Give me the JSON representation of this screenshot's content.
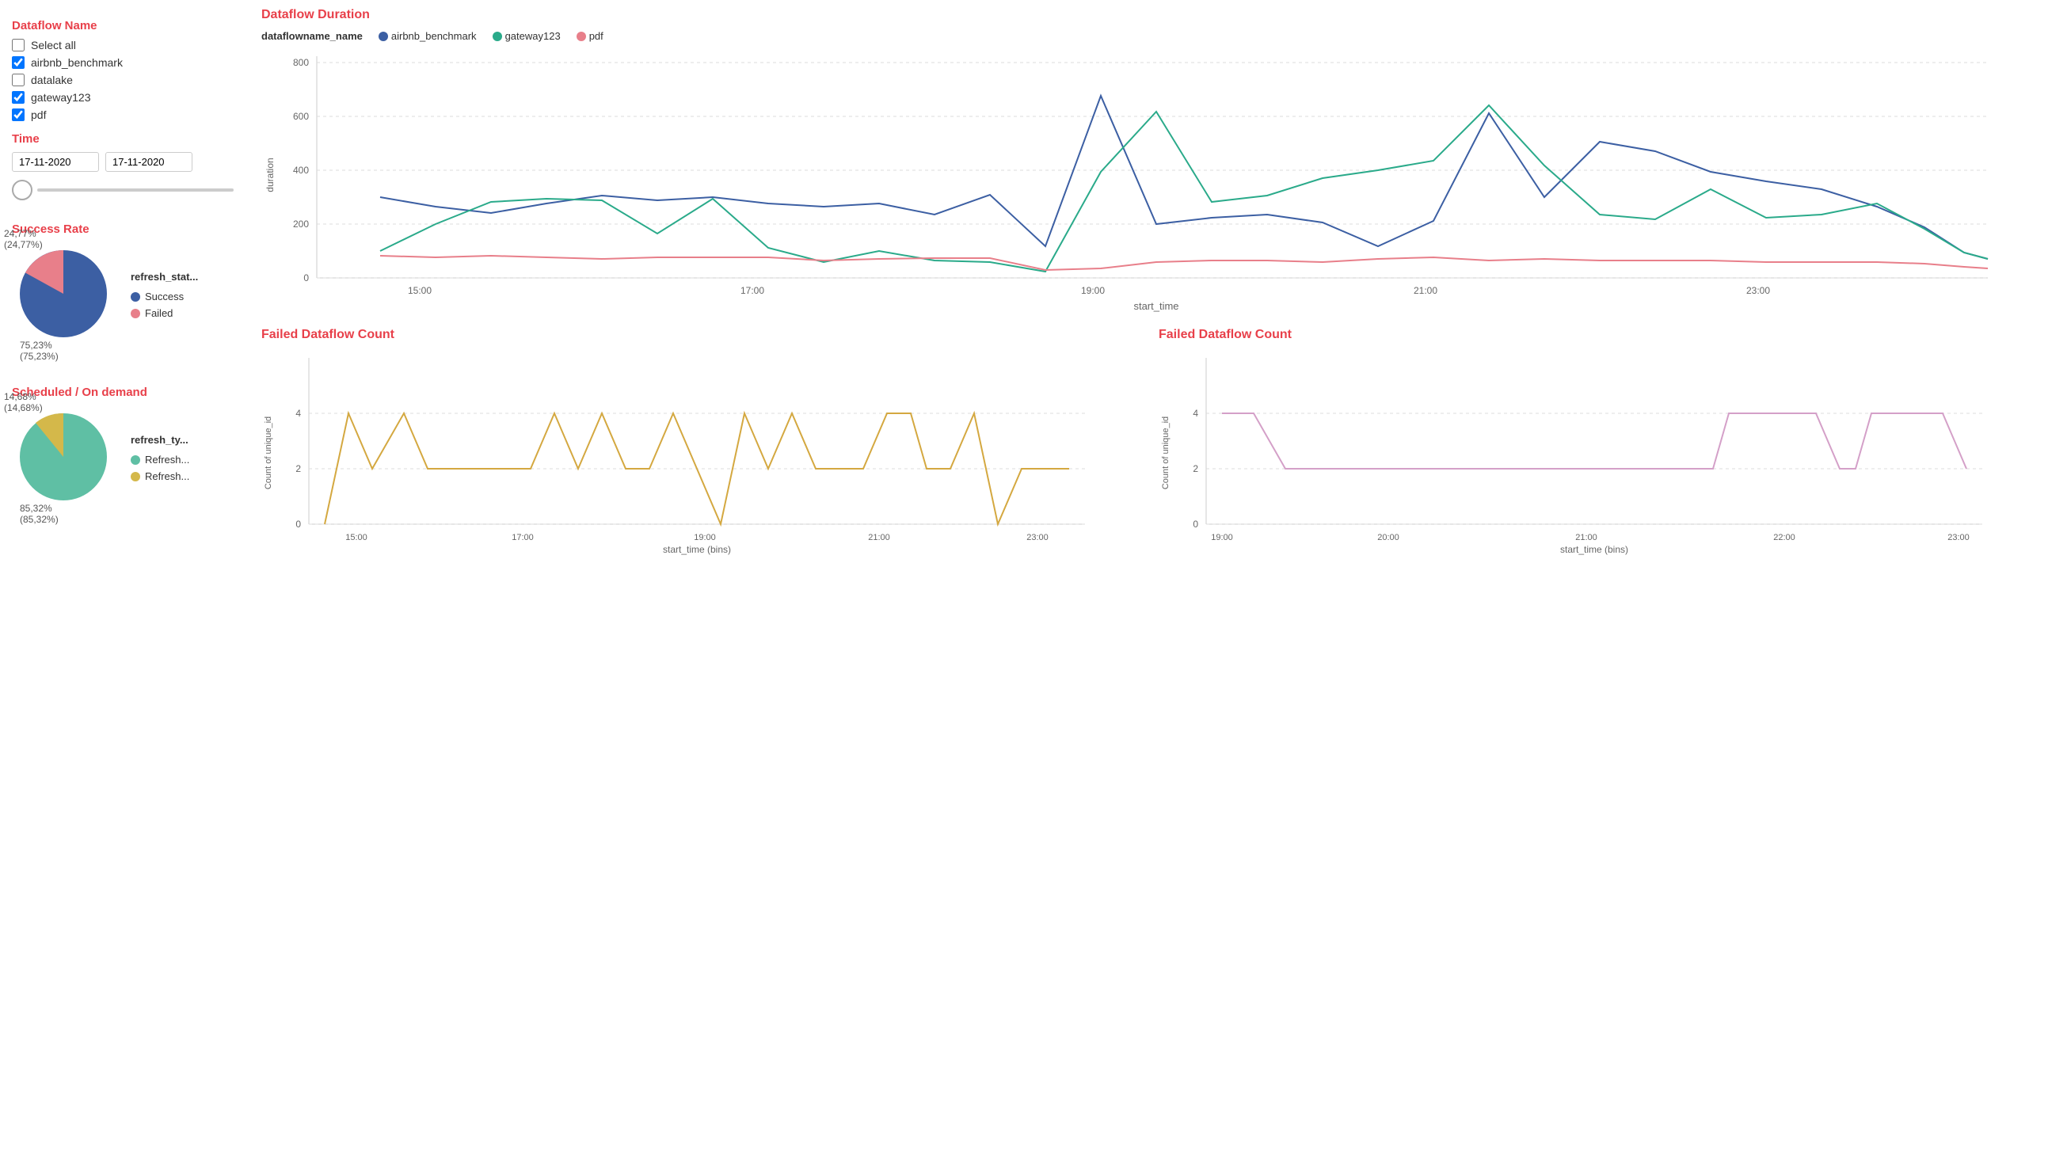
{
  "sidebar": {
    "dataflow_section_title": "Dataflow Name",
    "time_section_title": "Time",
    "success_rate_title": "Success Rate",
    "scheduled_title": "Scheduled / On demand",
    "select_all_label": "Select all",
    "checkboxes": [
      {
        "label": "airbnb_benchmark",
        "checked": true
      },
      {
        "label": "datalake",
        "checked": false
      },
      {
        "label": "gateway123",
        "checked": true
      },
      {
        "label": "pdf",
        "checked": true
      }
    ],
    "date_start": "17-11-2020",
    "date_end": "17-11-2020"
  },
  "pie1": {
    "legend_title": "refresh_stat...",
    "slices": [
      {
        "label": "Success",
        "color": "#3c5fa3",
        "pct": 75.23,
        "pct_label": "75,23%\n(75,23%)"
      },
      {
        "label": "Failed",
        "color": "#e87f8a",
        "pct": 24.77,
        "pct_label": "24,77%\n(24,77%)"
      }
    ]
  },
  "pie2": {
    "legend_title": "refresh_ty...",
    "slices": [
      {
        "label": "Refresh...",
        "color": "#5fbfa4",
        "pct": 85.32,
        "pct_label": "85,32%\n(85,32%)"
      },
      {
        "label": "Refresh...",
        "color": "#d4b84a",
        "pct": 14.68,
        "pct_label": "14,68%\n(14,68%)"
      }
    ]
  },
  "chart_duration": {
    "title": "Dataflow Duration",
    "legend_title": "dataflowname_name",
    "legend": [
      {
        "label": "airbnb_benchmark",
        "color": "#3c5fa3"
      },
      {
        "label": "gateway123",
        "color": "#2aaa8a"
      },
      {
        "label": "pdf",
        "color": "#e87f8a"
      }
    ],
    "y_label": "duration",
    "x_label": "start_time",
    "y_ticks": [
      "0",
      "200",
      "400",
      "600",
      "800"
    ],
    "x_ticks": [
      "15:00",
      "17:00",
      "19:00",
      "21:00",
      "23:00"
    ]
  },
  "chart_failed1": {
    "title": "Failed Dataflow Count",
    "y_label": "Count of unique_id",
    "x_label": "start_time (bins)",
    "y_ticks": [
      "0",
      "2",
      "4"
    ],
    "x_ticks": [
      "15:00",
      "17:00",
      "19:00",
      "21:00",
      "23:00"
    ],
    "color": "#d4a840"
  },
  "chart_failed2": {
    "title": "Failed Dataflow Count",
    "y_label": "Count of unique_id",
    "x_label": "start_time (bins)",
    "y_ticks": [
      "0",
      "2",
      "4"
    ],
    "x_ticks": [
      "19:00",
      "20:00",
      "21:00",
      "22:00",
      "23:00"
    ],
    "color": "#d4a0c8"
  }
}
